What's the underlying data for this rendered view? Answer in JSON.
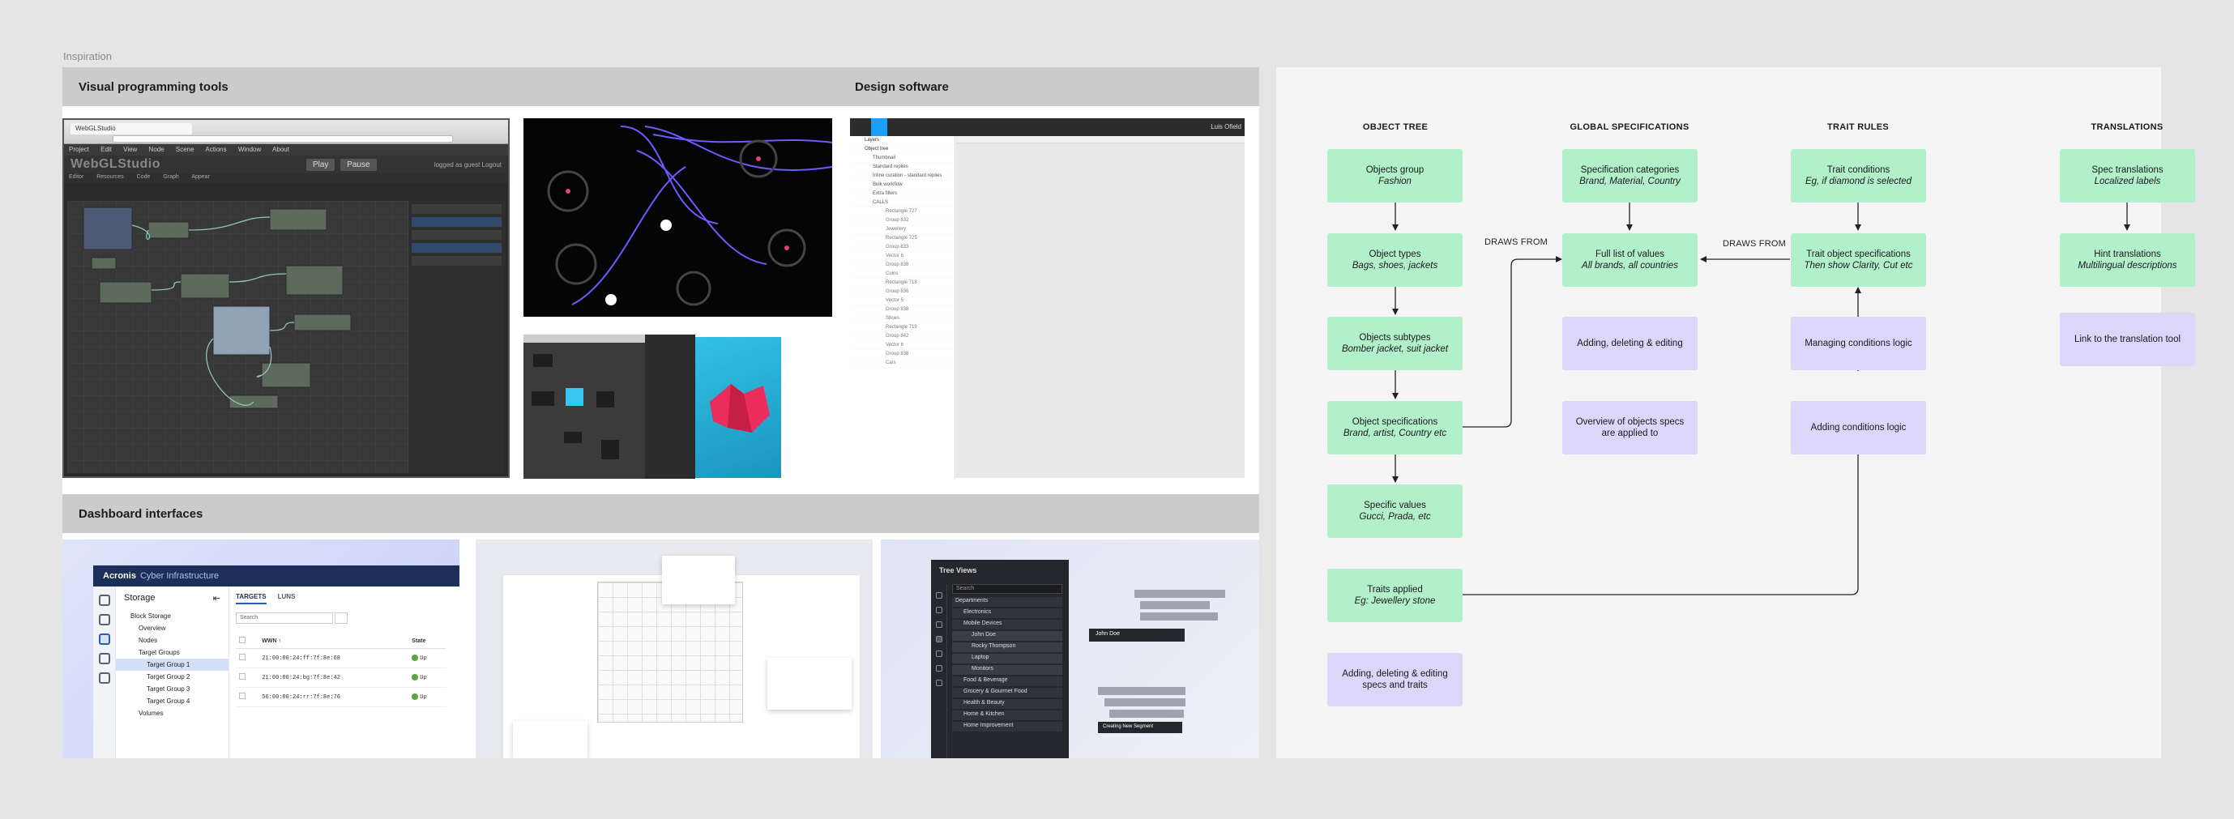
{
  "canvas": {
    "label": "Inspiration"
  },
  "sections": {
    "visual_programming": "Visual programming tools",
    "design_software": "Design software",
    "dashboard": "Dashboard interfaces"
  },
  "webgl": {
    "tab_title": "WebGLStudio",
    "menu": "Project   Edit   View   Node   Scene   Actions   Window   About",
    "app_title": "WebGLStudio",
    "play": "Play",
    "pause": "Pause",
    "login": "logged as guest  Logout",
    "toolbar": "Editor  Resources  Code  Graph  Appear"
  },
  "figma": {
    "user": "Luis Ofield",
    "layers": [
      {
        "label": "Layers",
        "kind": "top"
      },
      {
        "label": "Object tree",
        "kind": "top"
      },
      {
        "label": "Thumbnail",
        "kind": "grp"
      },
      {
        "label": "Standard replies",
        "kind": "grp"
      },
      {
        "label": "Inline curation - standard replies",
        "kind": "grp"
      },
      {
        "label": "Bulk workflow",
        "kind": "grp"
      },
      {
        "label": "Extra filters",
        "kind": "grp"
      },
      {
        "label": "CALLS",
        "kind": "grp"
      },
      {
        "label": "Rectangle 727",
        "kind": "sub"
      },
      {
        "label": "Group 832",
        "kind": "sub"
      },
      {
        "label": "Jewellery",
        "kind": "sub"
      },
      {
        "label": "Rectangle 725",
        "kind": "sub"
      },
      {
        "label": "Group 833",
        "kind": "sub"
      },
      {
        "label": "Vector 6",
        "kind": "sub"
      },
      {
        "label": "Group 838",
        "kind": "sub"
      },
      {
        "label": "Coins",
        "kind": "sub"
      },
      {
        "label": "Rectangle 718",
        "kind": "sub"
      },
      {
        "label": "Group 836",
        "kind": "sub"
      },
      {
        "label": "Vector 5",
        "kind": "sub"
      },
      {
        "label": "Group 838",
        "kind": "sub"
      },
      {
        "label": "Shoes",
        "kind": "sub"
      },
      {
        "label": "Rectangle 719",
        "kind": "sub"
      },
      {
        "label": "Group 842",
        "kind": "sub"
      },
      {
        "label": "Vector 6",
        "kind": "sub"
      },
      {
        "label": "Group 838",
        "kind": "sub"
      },
      {
        "label": "Cars",
        "kind": "sub"
      }
    ]
  },
  "acronis": {
    "brand": "Acronis",
    "product": "Cyber Infrastructure",
    "nav_title": "Storage",
    "nav": [
      {
        "label": "Block Storage",
        "level": 1,
        "active": false
      },
      {
        "label": "Overview",
        "level": 2,
        "active": false
      },
      {
        "label": "Nodes",
        "level": 2,
        "active": false
      },
      {
        "label": "Target Groups",
        "level": 2,
        "active": false
      },
      {
        "label": "Target Group 1",
        "level": 3,
        "active": true
      },
      {
        "label": "Target Group 2",
        "level": 3,
        "active": false
      },
      {
        "label": "Target Group 3",
        "level": 3,
        "active": false
      },
      {
        "label": "Target Group 4",
        "level": 3,
        "active": false
      },
      {
        "label": "Volumes",
        "level": 2,
        "active": false
      }
    ],
    "tabs": [
      "TARGETS",
      "LUNS"
    ],
    "search_placeholder": "Search",
    "columns": [
      "WWN",
      "State"
    ],
    "rows": [
      {
        "wwn": "21:00:00:24:ff:7f:8e:68",
        "state": "Up"
      },
      {
        "wwn": "21:00:00:24:bg:7f:8e:42",
        "state": "Up"
      },
      {
        "wwn": "56:00:00:24:rr:7f:8e:76",
        "state": "Up"
      }
    ]
  },
  "tree_views": {
    "title": "Tree Views",
    "search_placeholder": "Search",
    "rows": [
      {
        "label": "Departments",
        "level": 1
      },
      {
        "label": "Electronics",
        "level": 2
      },
      {
        "label": "Mobile Devices",
        "level": 2
      },
      {
        "label": "John Doe",
        "level": 3
      },
      {
        "label": "Rocky Thompson",
        "level": 3
      },
      {
        "label": "Laptop",
        "level": 3
      },
      {
        "label": "Monitors",
        "level": 3
      },
      {
        "label": "Food & Beverage",
        "level": 2
      },
      {
        "label": "Grocery & Gourmet Food",
        "level": 2
      },
      {
        "label": "Health & Beauty",
        "level": 2
      },
      {
        "label": "Home & Kitchen",
        "level": 2
      },
      {
        "label": "Home Improvement",
        "level": 2
      }
    ],
    "drag_item": "John Doe",
    "new_segment": "Creating New Segment"
  },
  "diagram": {
    "columns": [
      "OBJECT TREE",
      "GLOBAL SPECIFICATIONS",
      "TRAIT RULES",
      "TRANSLATIONS"
    ],
    "edge_labels": [
      "DRAWS FROM",
      "DRAWS FROM"
    ],
    "nodes": {
      "objects_group": {
        "title": "Objects group",
        "sub": "Fashion",
        "color": "green"
      },
      "object_types": {
        "title": "Object types",
        "sub": "Bags, shoes, jackets",
        "color": "green"
      },
      "objects_subtypes": {
        "title": "Objects subtypes",
        "sub": "Bomber jacket, suit jacket",
        "color": "green"
      },
      "object_specs": {
        "title": "Object specifications",
        "sub": "Brand, artist, Country etc",
        "color": "green"
      },
      "specific_values": {
        "title": "Specific values",
        "sub": "Gucci, Prada, etc",
        "color": "green"
      },
      "traits_applied": {
        "title": "Traits applied",
        "sub": "Eg: Jewellery stone",
        "color": "green"
      },
      "add_delete_specs": {
        "title": "Adding, deleting & editing specs and traits",
        "sub": "",
        "color": "purple"
      },
      "spec_categories": {
        "title": "Specification categories",
        "sub": "Brand, Material, Country",
        "color": "green"
      },
      "full_list": {
        "title": "Full list of values",
        "sub": "All brands, all countries",
        "color": "green"
      },
      "add_delete_edit": {
        "title": "Adding, deleting & editing",
        "sub": "",
        "color": "purple"
      },
      "overview_specs": {
        "title": "Overview of objects specs are applied to",
        "sub": "",
        "color": "purple"
      },
      "trait_conditions": {
        "title": "Trait conditions",
        "sub": "Eg, if diamond is selected",
        "color": "green"
      },
      "trait_object_specs": {
        "title": "Trait object specifications",
        "sub": "Then show Clarity, Cut etc",
        "color": "green"
      },
      "managing_conditions": {
        "title": "Managing conditions logic",
        "sub": "",
        "color": "purple"
      },
      "adding_conditions": {
        "title": "Adding conditions logic",
        "sub": "",
        "color": "purple"
      },
      "spec_translations": {
        "title": "Spec translations",
        "sub": "Localized labels",
        "color": "green"
      },
      "hint_translations": {
        "title": "Hint translations",
        "sub": "Multilingual descriptions",
        "color": "green"
      },
      "link_translation": {
        "title": "Link to the translation tool",
        "sub": "",
        "color": "purple"
      }
    },
    "colors": {
      "green": "#b2efcb",
      "purple": "#dcd6fb",
      "edge": "#222222"
    }
  }
}
